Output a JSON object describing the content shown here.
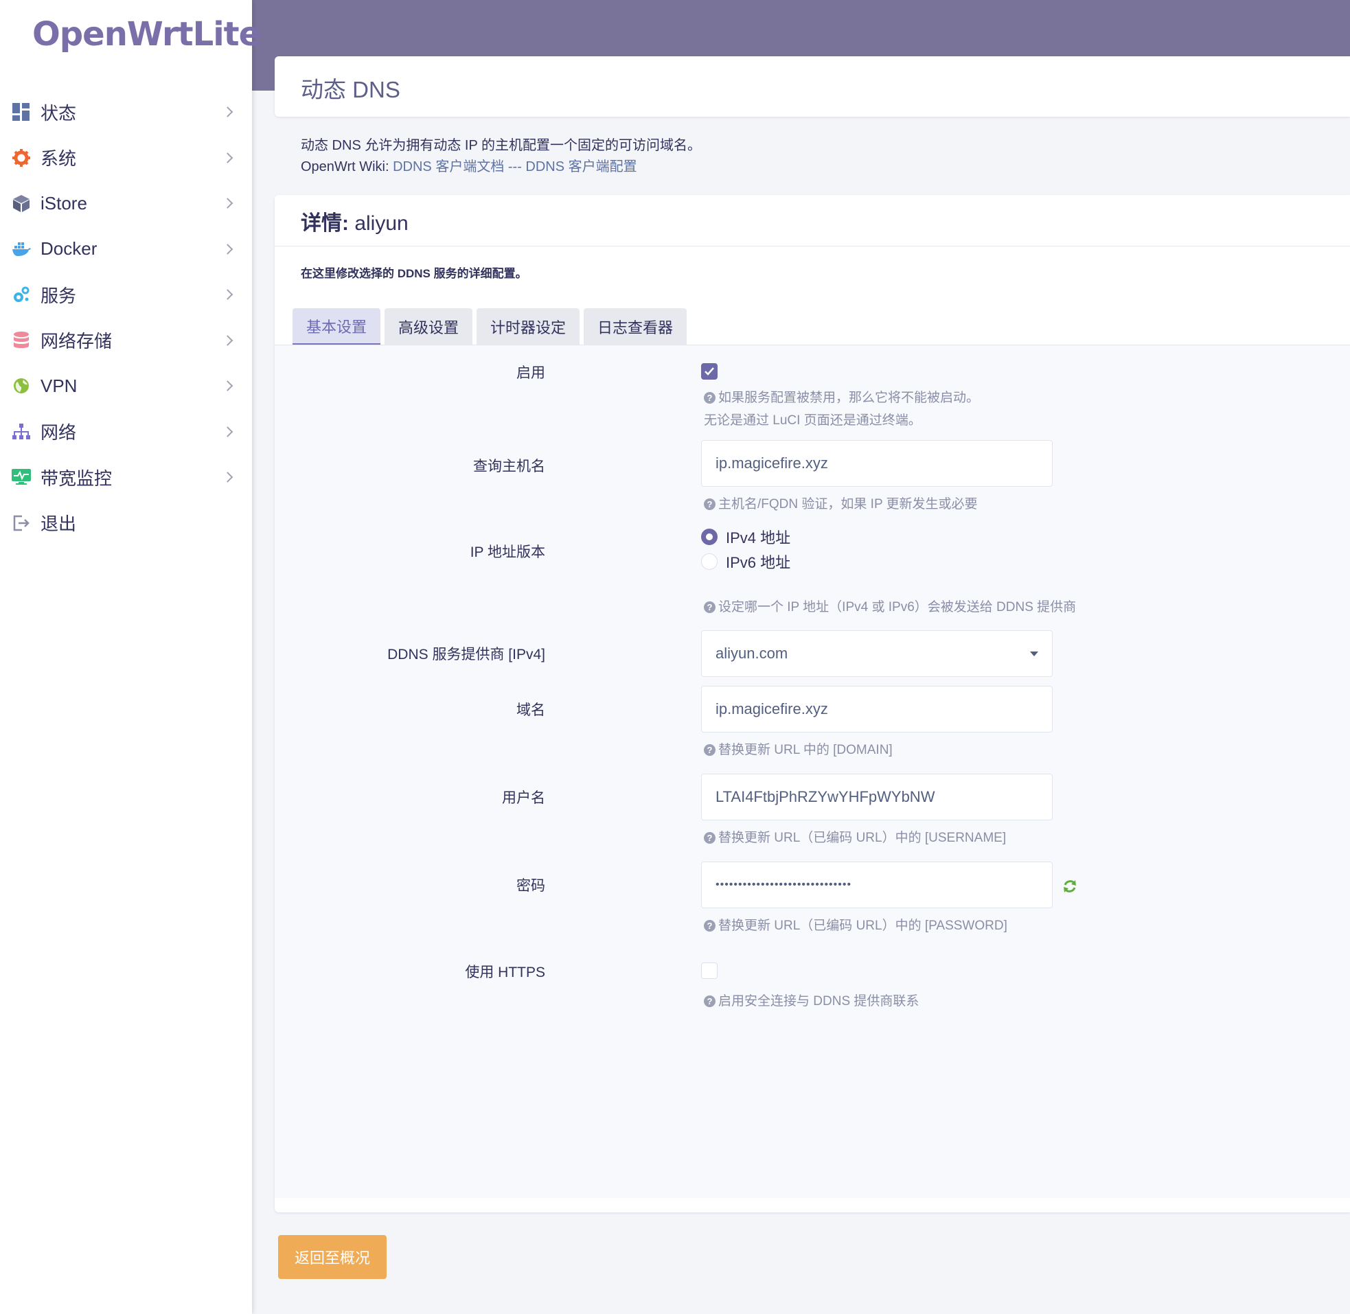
{
  "app": {
    "logo": "OpenWrtLite"
  },
  "sidebar": {
    "items": [
      {
        "label": "状态",
        "icon": "dashboard-icon",
        "color": "#5e72a4"
      },
      {
        "label": "系统",
        "icon": "gear-icon",
        "color": "#f0662f"
      },
      {
        "label": "iStore",
        "icon": "box-icon",
        "color": "#6a6f8f"
      },
      {
        "label": "Docker",
        "icon": "docker-icon",
        "color": "#4aa3e6"
      },
      {
        "label": "服务",
        "icon": "cogs-icon",
        "color": "#3fb3e8"
      },
      {
        "label": "网络存储",
        "icon": "database-icon",
        "color": "#f0899a"
      },
      {
        "label": "VPN",
        "icon": "globe-icon",
        "color": "#8cbf3f"
      },
      {
        "label": "网络",
        "icon": "sitemap-icon",
        "color": "#7a6fd0"
      },
      {
        "label": "带宽监控",
        "icon": "monitor-icon",
        "color": "#2fbf7a"
      },
      {
        "label": "退出",
        "icon": "logout-icon",
        "color": "#8a8ea6"
      }
    ]
  },
  "page": {
    "title": "动态 DNS",
    "intro_line1": "动态 DNS 允许为拥有动态 IP 的主机配置一个固定的可访问域名。",
    "intro_prefix": "OpenWrt Wiki: ",
    "link1": "DDNS 客户端文档",
    "link_sep": " --- ",
    "link2": "DDNS 客户端配置"
  },
  "detail": {
    "title_bold": "详情:",
    "title_name": " aliyun",
    "description": "在这里修改选择的 DDNS 服务的详细配置。",
    "tabs": [
      "基本设置",
      "高级设置",
      "计时器设定",
      "日志查看器"
    ],
    "active_tab": 0
  },
  "form": {
    "enable": {
      "label": "启用",
      "checked": true,
      "help1": "如果服务配置被禁用，那么它将不能被启动。",
      "help2": "无论是通过 LuCI 页面还是通过终端。"
    },
    "lookup_host": {
      "label": "查询主机名",
      "value": "ip.magicefire.xyz",
      "help": "主机名/FQDN 验证，如果 IP 更新发生或必要"
    },
    "ip_version": {
      "label": "IP 地址版本",
      "options": [
        "IPv4 地址",
        "IPv6 地址"
      ],
      "selected": 0,
      "help": "设定哪一个 IP 地址（IPv4 或 IPv6）会被发送给 DDNS 提供商"
    },
    "provider": {
      "label": "DDNS 服务提供商 [IPv4]",
      "value": "aliyun.com"
    },
    "domain": {
      "label": "域名",
      "value": "ip.magicefire.xyz",
      "help": "替换更新 URL 中的 [DOMAIN]"
    },
    "username": {
      "label": "用户名",
      "value": "LTAI4FtbjPhRZYwYHFpWYbNW",
      "help": "替换更新 URL（已编码 URL）中的 [USERNAME]"
    },
    "password": {
      "label": "密码",
      "value": "••••••••••••••••••••••••••••••",
      "help": "替换更新 URL（已编码 URL）中的 [PASSWORD]"
    },
    "https": {
      "label": "使用 HTTPS",
      "checked": false,
      "help": "启用安全连接与 DDNS 提供商联系"
    }
  },
  "footer": {
    "back_label": "返回至概况"
  },
  "colors": {
    "accent": "#6d68a8",
    "header": "#7a7399",
    "button": "#f0ab57"
  }
}
